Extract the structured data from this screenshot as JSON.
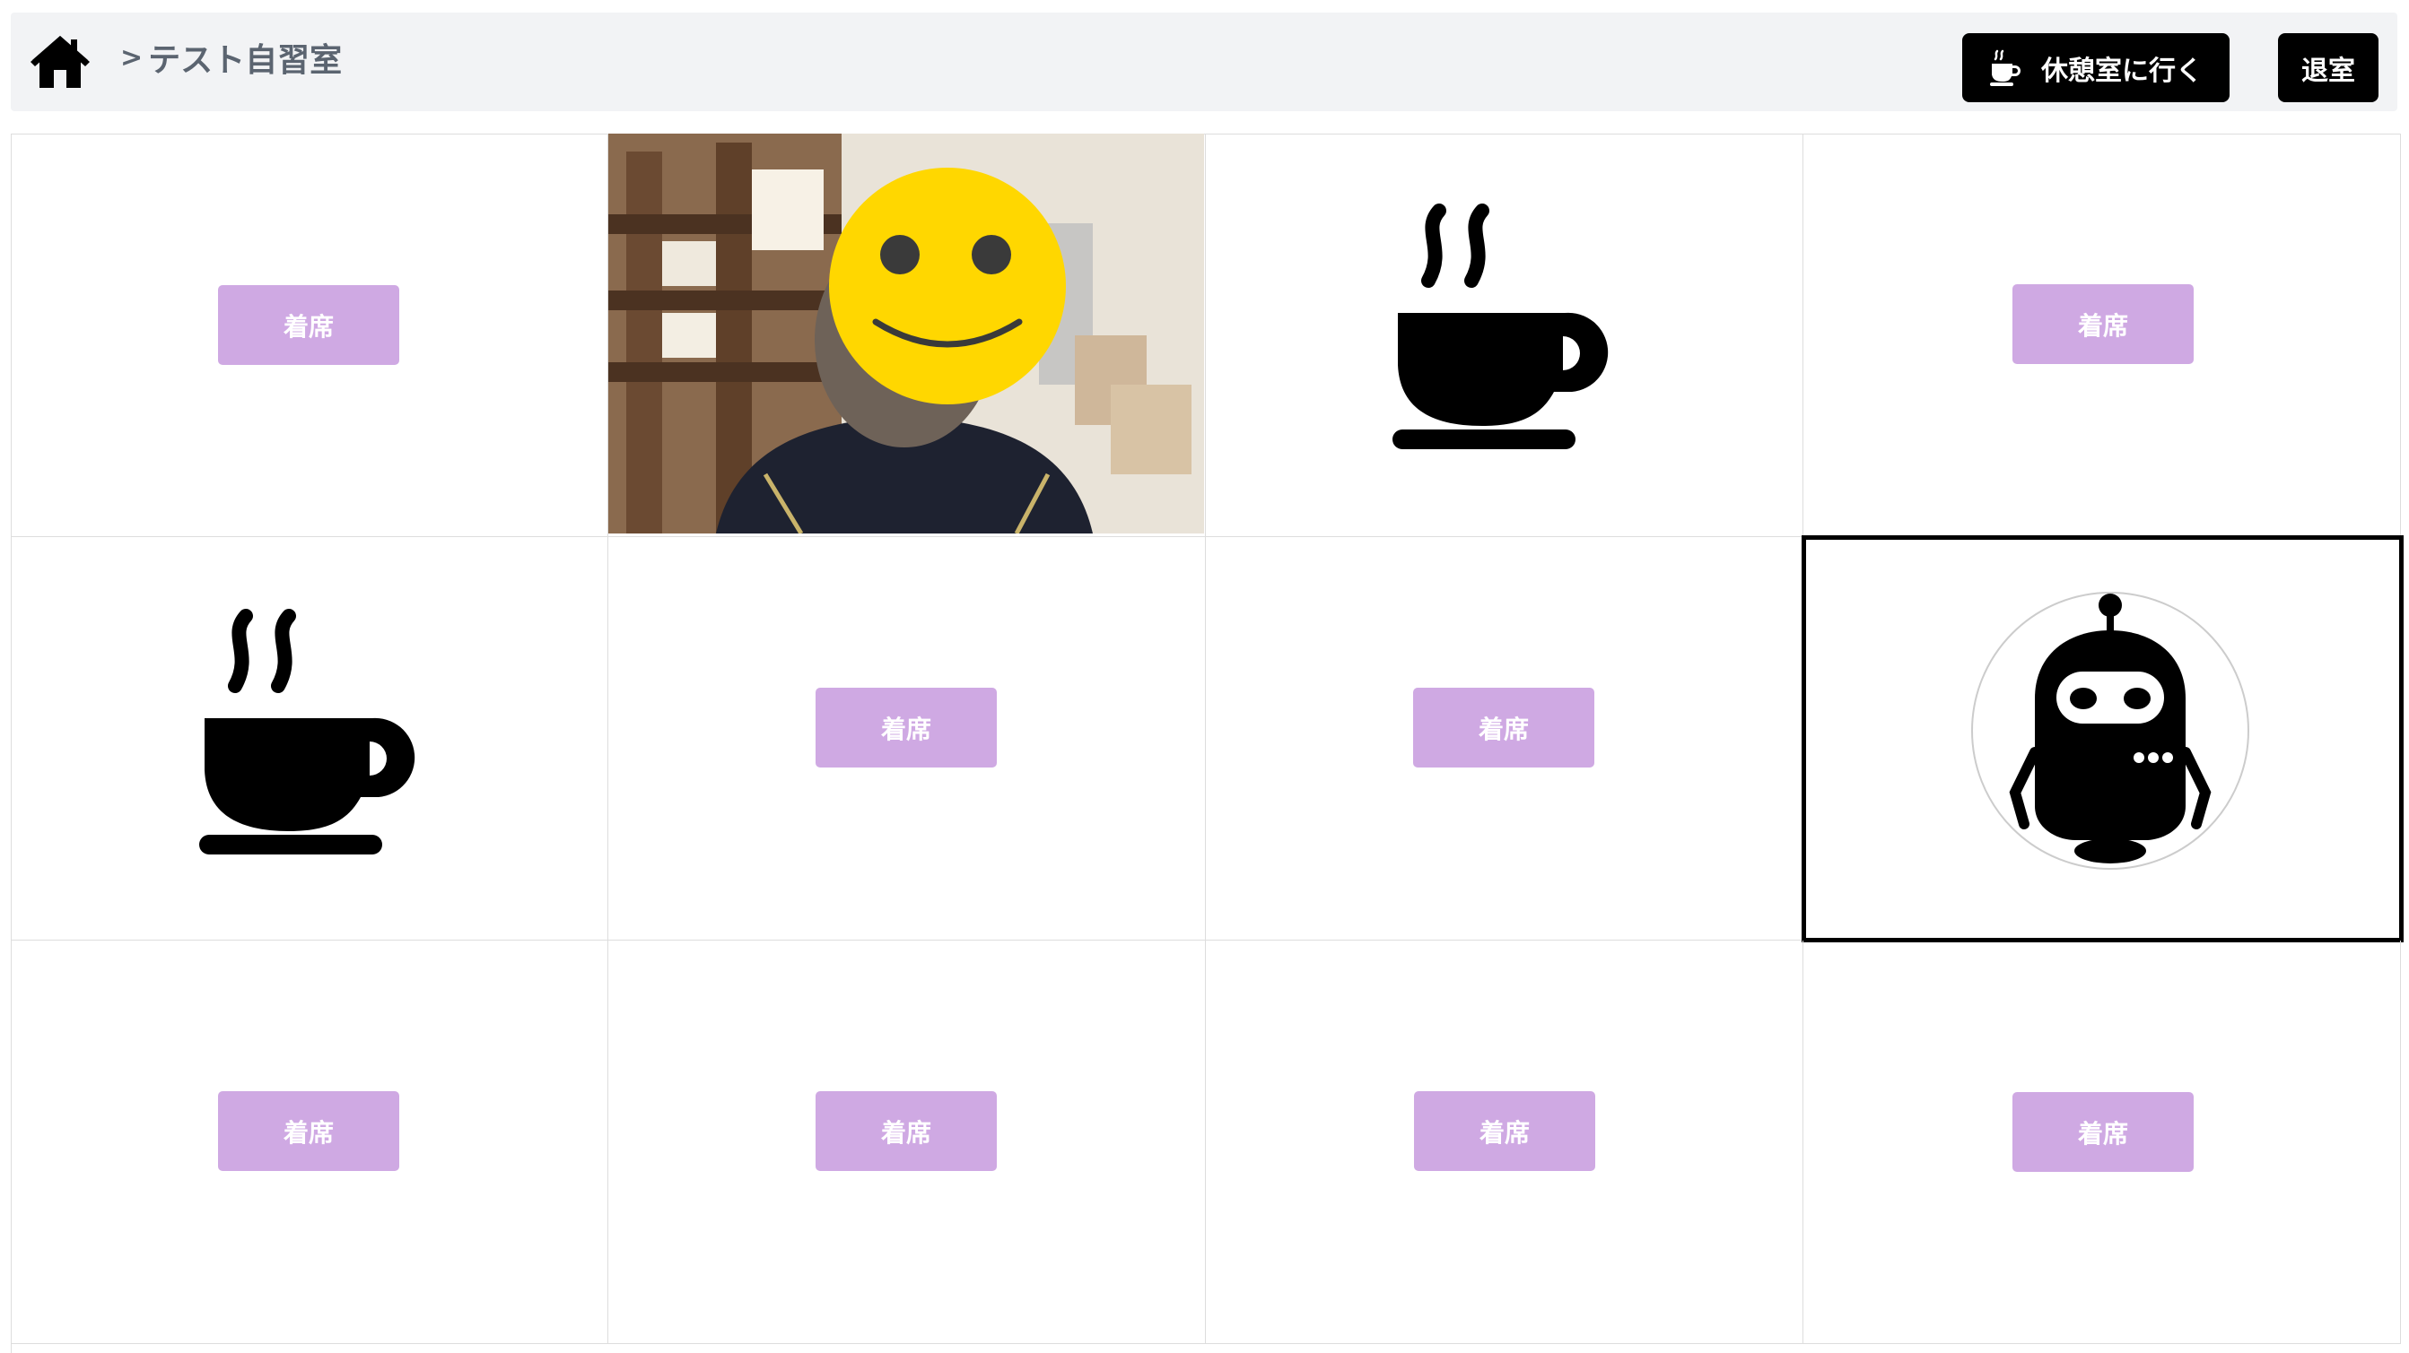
{
  "header": {
    "breadcrumb_separator": ">",
    "room_name": "テスト自習室",
    "break_button_label": "休憩室に行く",
    "exit_button_label": "退室"
  },
  "icons": {
    "home": "home-icon",
    "coffee": "coffee-cup-icon",
    "robot": "robot-avatar-icon",
    "smiley": "smiley-face-icon"
  },
  "colors": {
    "header_bg": "#f2f3f5",
    "seat_button": "#cfa9e3",
    "dark_button": "#000000",
    "smiley": "#ffd700"
  },
  "seats": [
    {
      "row": 1,
      "col": 1,
      "state": "empty",
      "label": "着席"
    },
    {
      "row": 1,
      "col": 2,
      "state": "camera"
    },
    {
      "row": 1,
      "col": 3,
      "state": "on-break"
    },
    {
      "row": 1,
      "col": 4,
      "state": "empty",
      "label": "着席"
    },
    {
      "row": 2,
      "col": 1,
      "state": "on-break"
    },
    {
      "row": 2,
      "col": 2,
      "state": "empty",
      "label": "着席"
    },
    {
      "row": 2,
      "col": 3,
      "state": "empty",
      "label": "着席"
    },
    {
      "row": 2,
      "col": 4,
      "state": "robot",
      "selected": true
    },
    {
      "row": 3,
      "col": 1,
      "state": "empty",
      "label": "着席"
    },
    {
      "row": 3,
      "col": 2,
      "state": "empty",
      "label": "着席"
    },
    {
      "row": 3,
      "col": 3,
      "state": "empty",
      "label": "着席"
    },
    {
      "row": 3,
      "col": 4,
      "state": "empty",
      "label": "着席"
    }
  ]
}
